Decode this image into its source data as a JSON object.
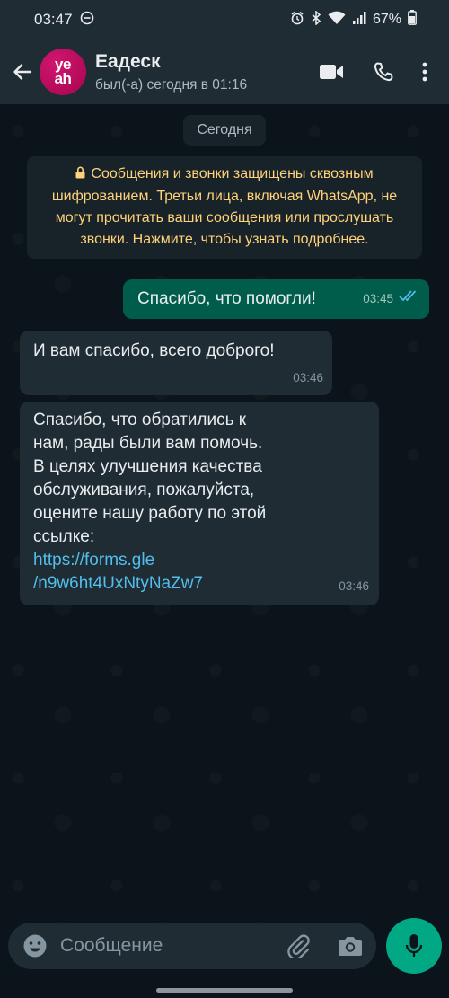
{
  "status_bar": {
    "time": "03:47",
    "battery": "67%"
  },
  "header": {
    "avatar_text_top": "ye",
    "avatar_text_bottom": "ah",
    "contact_name": "Еадеск",
    "contact_status": "был(-а) сегодня в 01:16"
  },
  "chat": {
    "date_chip": "Сегодня",
    "encryption_notice": "Сообщения и звонки защищены сквозным шифрованием. Третьи лица, включая WhatsApp, не могут прочитать ваши сообщения или прослушать звонки. Нажмите, чтобы узнать подробнее.",
    "messages": [
      {
        "direction": "outgoing",
        "text": "Спасибо, что помогли!",
        "time": "03:45",
        "status": "read"
      },
      {
        "direction": "incoming",
        "text": "И вам спасибо, всего доброго!",
        "time": "03:46"
      },
      {
        "direction": "incoming",
        "lines": [
          "Спасибо, что обратились к",
          "нам, рады были вам помочь.",
          "В целях улучшения качества",
          "обслуживания, пожалуйста,",
          "оцените нашу работу по этой",
          "ссылке:"
        ],
        "link_lines": [
          "https://forms.gle",
          "/n9w6ht4UxNtyNaZw7"
        ],
        "time": "03:46"
      }
    ]
  },
  "composer": {
    "placeholder": "Сообщение"
  },
  "colors": {
    "header_bg": "#1f2c34",
    "chat_bg": "#0b141a",
    "outgoing_bubble": "#005c4b",
    "incoming_bubble": "#1f2c34",
    "notice_text": "#ffd279",
    "link": "#53bdeb",
    "accent": "#00a884",
    "read_ticks": "#53bdeb"
  }
}
